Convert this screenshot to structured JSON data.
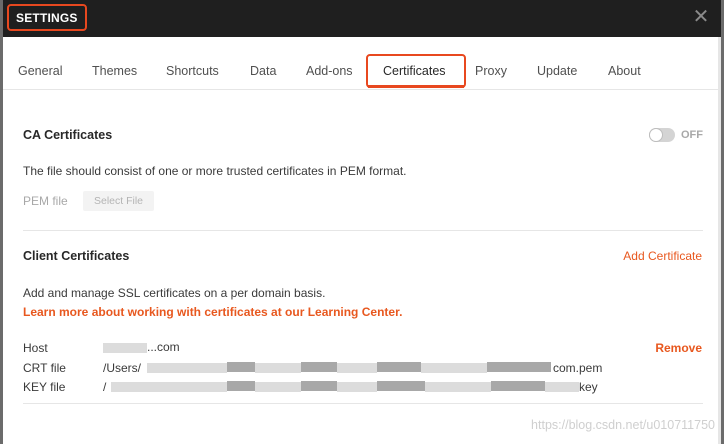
{
  "window": {
    "title": "SETTINGS",
    "close_glyph": "✕"
  },
  "tabs": [
    {
      "label": "General"
    },
    {
      "label": "Themes"
    },
    {
      "label": "Shortcuts"
    },
    {
      "label": "Data"
    },
    {
      "label": "Add-ons"
    },
    {
      "label": "Certificates",
      "active": true
    },
    {
      "label": "Proxy"
    },
    {
      "label": "Update"
    },
    {
      "label": "About"
    }
  ],
  "ca": {
    "title": "CA Certificates",
    "toggle_label": "OFF",
    "toggle_state": "off",
    "description": "The file should consist of one or more trusted certificates in PEM format.",
    "pem_label": "PEM file",
    "select_file_label": "Select File"
  },
  "client": {
    "title": "Client Certificates",
    "add_label": "Add Certificate",
    "description": "Add and manage SSL certificates on a per domain basis.",
    "learn_more": "Learn more about working with certificates at our Learning Center.",
    "host_label": "Host",
    "host_value": "...com",
    "remove_label": "Remove",
    "crt_label": "CRT file",
    "crt_value_start": "/Users/",
    "crt_value_end": "com.pem",
    "key_label": "KEY file",
    "key_value_start": "/",
    "key_value_end": "key"
  },
  "watermark": "https://blog.csdn.net/u010711750",
  "colors": {
    "accent": "#e8481f",
    "link": "#e8581f",
    "titlebar": "#1f1f1f"
  }
}
